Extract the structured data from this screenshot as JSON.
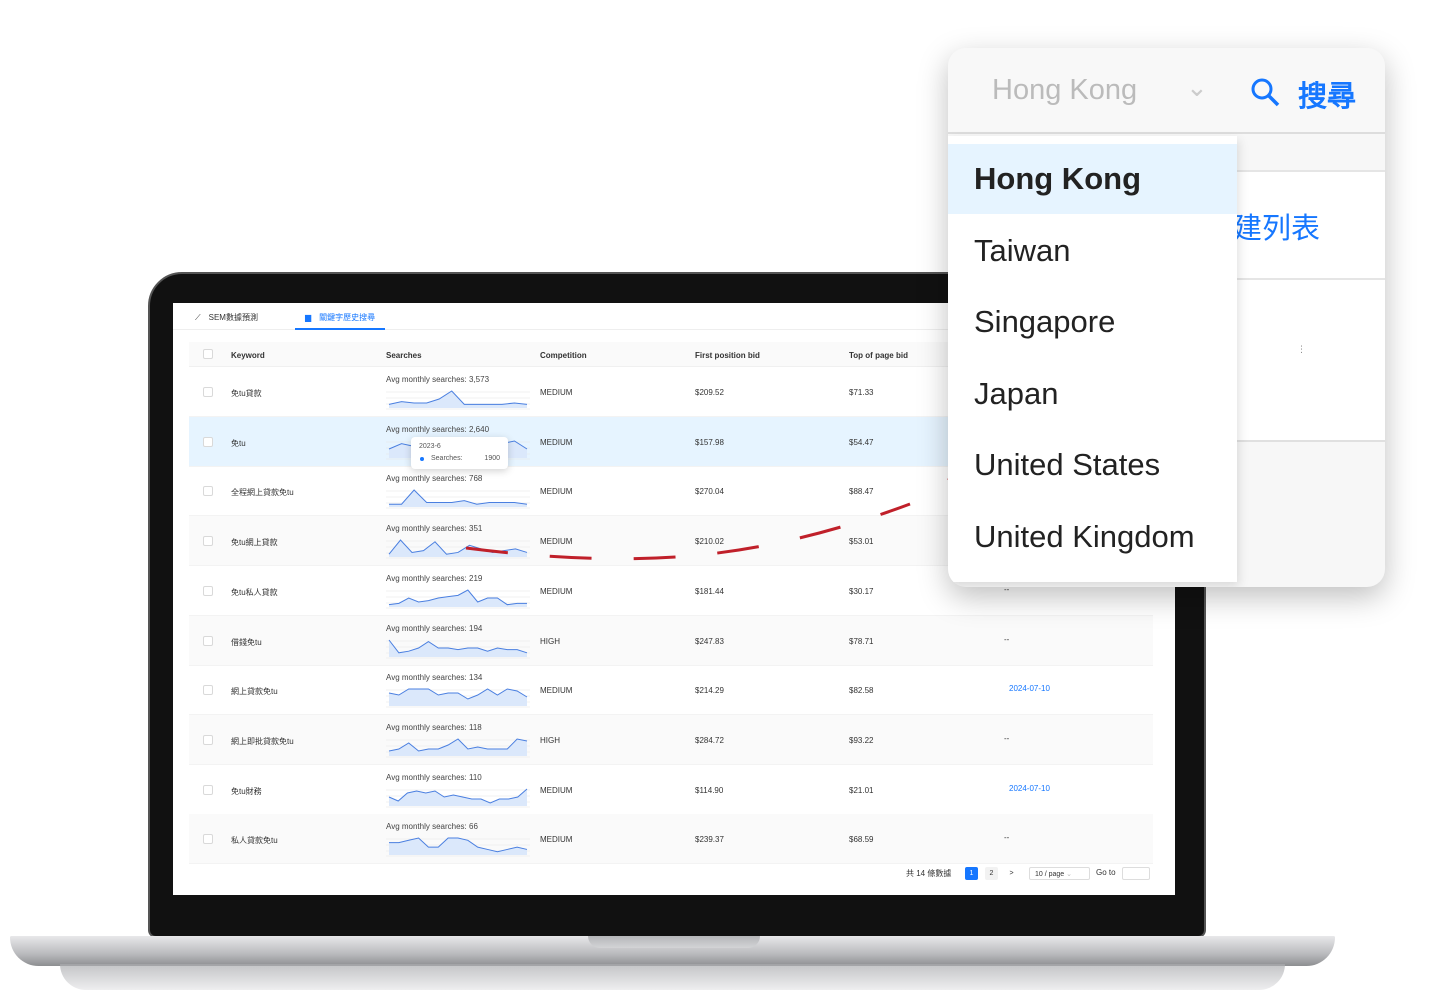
{
  "tabs": [
    {
      "label": "SEM數據預測",
      "icon": "line-chart-icon",
      "active": false
    },
    {
      "label": "關鍵字歷史搜尋",
      "icon": "bar-chart-icon",
      "active": true
    }
  ],
  "table": {
    "columns": [
      "Keyword",
      "Searches",
      "Competition",
      "First position bid",
      "Top of page bid"
    ],
    "rows": [
      {
        "keyword": "免tu貸款",
        "avg": "Avg monthly searches: 3,573",
        "competition": "MEDIUM",
        "first_bid": "$209.52",
        "top_bid": "$71.33",
        "extra": "",
        "spark": [
          2,
          4,
          3,
          3,
          6,
          12,
          2,
          2,
          2,
          2,
          3,
          2
        ]
      },
      {
        "keyword": "免tu",
        "avg": "Avg monthly searches: 2,640",
        "competition": "MEDIUM",
        "first_bid": "$157.98",
        "top_bid": "$54.47",
        "extra": "",
        "spark": [
          3,
          5,
          4,
          4,
          4,
          4,
          4,
          4,
          4,
          5,
          6,
          3
        ]
      },
      {
        "keyword": "全程網上貸款免tu",
        "avg": "Avg monthly searches: 768",
        "competition": "MEDIUM",
        "first_bid": "$270.04",
        "top_bid": "$88.47",
        "extra": "",
        "spark": [
          1,
          1,
          9,
          2,
          2,
          2,
          3,
          1,
          2,
          2,
          2,
          1
        ]
      },
      {
        "keyword": "免tu網上貸款",
        "avg": "Avg monthly searches: 351",
        "competition": "MEDIUM",
        "first_bid": "$210.02",
        "top_bid": "$53.01",
        "extra": "",
        "spark": [
          1,
          9,
          2,
          3,
          8,
          1,
          2,
          6,
          4,
          2,
          3,
          4,
          2
        ]
      },
      {
        "keyword": "免tu私人貸款",
        "avg": "Avg monthly searches: 219",
        "competition": "MEDIUM",
        "first_bid": "$181.44",
        "top_bid": "$30.17",
        "extra": "--",
        "spark": [
          1,
          2,
          6,
          3,
          4,
          6,
          7,
          8,
          12,
          3,
          6,
          6,
          1,
          2,
          2
        ]
      },
      {
        "keyword": "借錢免tu",
        "avg": "Avg monthly searches: 194",
        "competition": "HIGH",
        "first_bid": "$247.83",
        "top_bid": "$78.71",
        "extra": "--",
        "spark": [
          10,
          2,
          3,
          5,
          9,
          5,
          5,
          4,
          5,
          5,
          3,
          5,
          4,
          4,
          2
        ]
      },
      {
        "keyword": "網上貸款免tu",
        "avg": "Avg monthly searches: 134",
        "competition": "MEDIUM",
        "first_bid": "$214.29",
        "top_bid": "$82.58",
        "extra": "2024-07-10",
        "spark": [
          6,
          5,
          8,
          8,
          8,
          5,
          6,
          6,
          3,
          5,
          8,
          5,
          8,
          7,
          4
        ]
      },
      {
        "keyword": "網上即批貸款免tu",
        "avg": "Avg monthly searches: 118",
        "competition": "HIGH",
        "first_bid": "$284.72",
        "top_bid": "$93.22",
        "extra": "--",
        "spark": [
          2,
          3,
          6,
          2,
          3,
          3,
          5,
          8,
          3,
          4,
          3,
          3,
          3,
          8,
          7
        ]
      },
      {
        "keyword": "免tu財務",
        "avg": "Avg monthly searches: 110",
        "competition": "MEDIUM",
        "first_bid": "$114.90",
        "top_bid": "$21.01",
        "extra": "2024-07-10",
        "spark": [
          4,
          2,
          6,
          7,
          6,
          7,
          4,
          5,
          4,
          3,
          3,
          1,
          3,
          3,
          4,
          8
        ]
      },
      {
        "keyword": "私人貸款免tu",
        "avg": "Avg monthly searches: 66",
        "competition": "MEDIUM",
        "first_bid": "$239.37",
        "top_bid": "$68.59",
        "extra": "--",
        "spark": [
          5,
          5,
          6,
          7,
          3,
          3,
          7,
          7,
          6,
          3,
          2,
          1,
          2,
          3,
          2
        ]
      }
    ],
    "tooltip": {
      "date": "2023-6",
      "label": "Searches:",
      "value": "1900"
    }
  },
  "pagination": {
    "total": "共 14 條數據",
    "pages": [
      "1",
      "2"
    ],
    "current": "1",
    "next": ">",
    "page_size": "10 / page",
    "goto": "Go to"
  },
  "region_panel": {
    "selected": "Hong Kong",
    "search_label": "搜尋",
    "partial_label": "建列表",
    "options": [
      "Hong Kong",
      "Taiwan",
      "Singapore",
      "Japan",
      "United States",
      "United Kingdom"
    ]
  },
  "colors": {
    "accent": "#1677ff",
    "selected_bg": "#e6f4ff",
    "arrow": "#c0202a"
  }
}
